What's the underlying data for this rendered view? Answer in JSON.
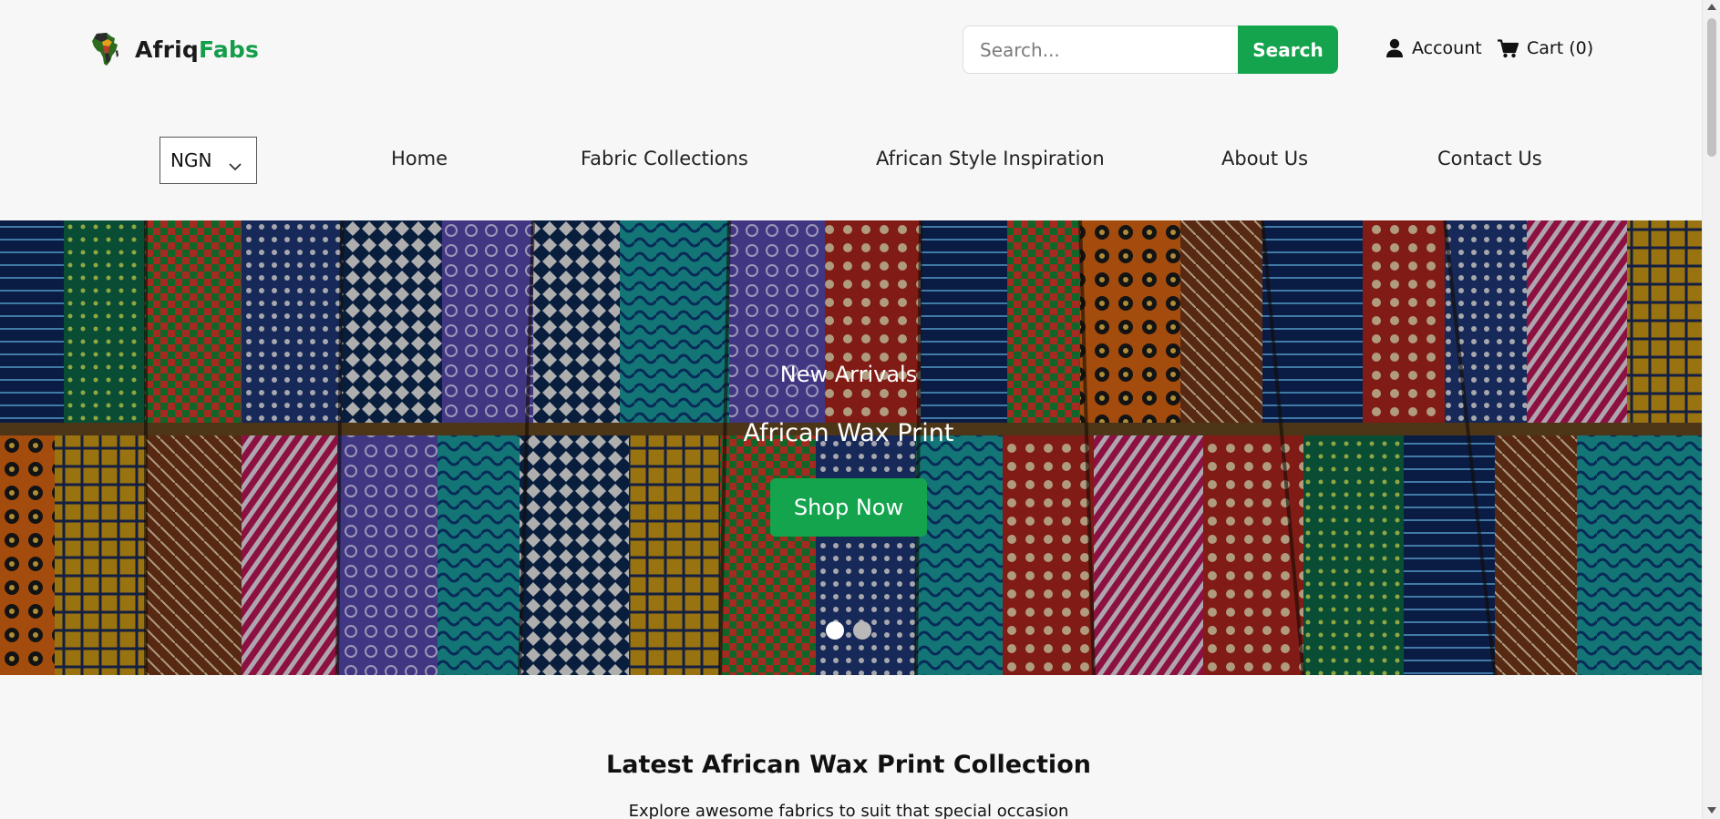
{
  "header": {
    "logo_part1": "Afriq",
    "logo_part2": "Fabs",
    "search_placeholder": "Search...",
    "search_button": "Search",
    "account_label": "Account",
    "cart_label": "Cart (0)"
  },
  "nav": {
    "currency": "NGN",
    "items": [
      "Home",
      "Fabric Collections",
      "African Style Inspiration",
      "About Us",
      "Contact Us"
    ]
  },
  "hero": {
    "subtitle": "New Arrivals",
    "title": "African Wax Print",
    "button": "Shop Now",
    "slides_total": 2,
    "active_slide": 1
  },
  "section": {
    "title": "Latest African Wax Print Collection",
    "subtitle": "Explore awesome fabrics to suit that special occasion"
  },
  "colors": {
    "brand_green": "#14a44d",
    "logo_dark": "#1a1a1a"
  },
  "icons": {
    "logo": "africa-map-icon",
    "account": "user-icon",
    "cart": "cart-icon",
    "currency_chevron": "chevron-down-icon"
  }
}
